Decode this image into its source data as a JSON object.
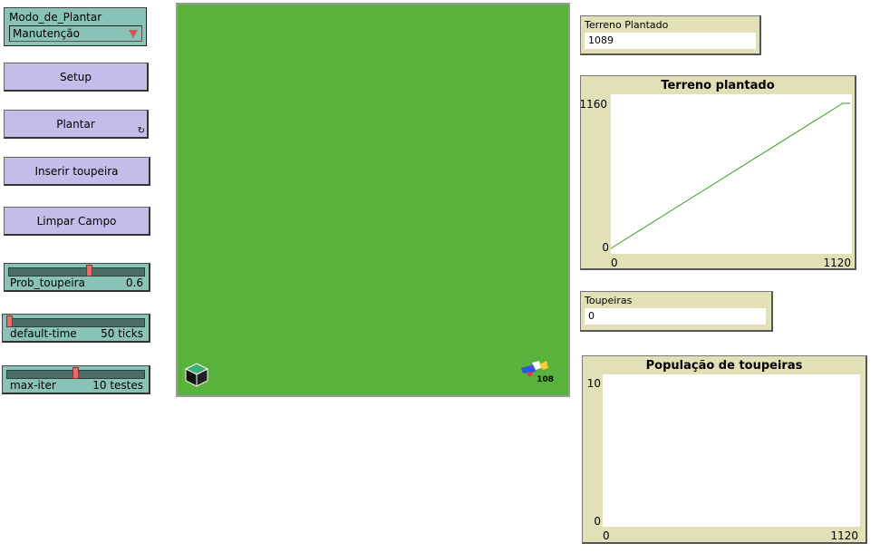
{
  "chooser": {
    "label": "Modo_de_Plantar",
    "value": "Manutenção"
  },
  "buttons": {
    "setup": "Setup",
    "plantar": "Plantar",
    "inserir": "Inserir toupeira",
    "limpar": "Limpar Campo"
  },
  "sliders": [
    {
      "name": "Prob_toupeira",
      "value": "0.6",
      "fraction": 0.6
    },
    {
      "name": "default-time",
      "value": "50 ticks",
      "fraction": 0.0
    },
    {
      "name": "max-iter",
      "value": "10 testes",
      "fraction": 0.5
    }
  ],
  "view": {
    "speed_label": "108",
    "background": "#59b23b"
  },
  "monitors": {
    "terreno": {
      "label": "Terreno Plantado",
      "value": "1089"
    },
    "toupeiras": {
      "label": "Toupeiras",
      "value": "0"
    }
  },
  "plots": {
    "terreno": {
      "title": "Terreno plantado",
      "ymax": "1160",
      "ymin": "0",
      "xmin": "0",
      "xmax": "1120"
    },
    "populacao": {
      "title": "População de toupeiras",
      "ymax": "10",
      "ymin": "0",
      "xmin": "0",
      "xmax": "1120"
    }
  },
  "chart_data": [
    {
      "type": "line",
      "title": "Terreno plantado",
      "xlim": [
        0,
        1120
      ],
      "ylim": [
        0,
        1160
      ],
      "series": [
        {
          "color": "#3a9a1a",
          "x": [
            0,
            1085,
            1120
          ],
          "y": [
            0,
            1160,
            1160
          ]
        }
      ]
    },
    {
      "type": "line",
      "title": "População de toupeiras",
      "xlim": [
        0,
        1120
      ],
      "ylim": [
        0,
        10
      ],
      "series": []
    }
  ]
}
